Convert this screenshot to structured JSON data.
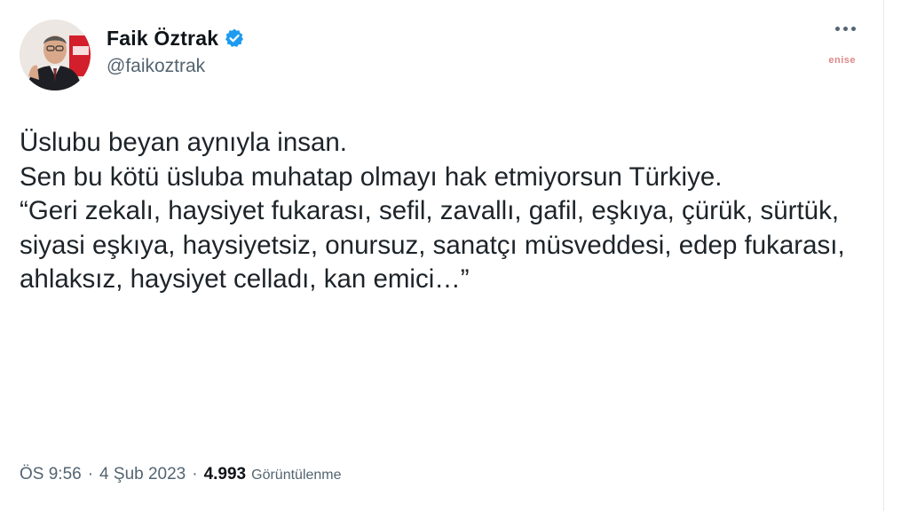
{
  "author": {
    "display_name": "Faik Öztrak",
    "handle": "@faikoztrak",
    "verified": true,
    "avatar_icon": "profile-photo"
  },
  "tweet": {
    "text": "Üslubu beyan aynıyla insan.\nSen bu kötü üsluba muhatap olmayı hak etmiyorsun Türkiye.\n“Geri zekalı, haysiyet fukarası, sefil, zavallı, gafil, eşkıya, çürük, sürtük, siyasi eşkıya, haysiyetsiz, onursuz, sanatçı müsveddesi, edep fukarası, ahlaksız, haysiyet celladı, kan emici…”"
  },
  "meta": {
    "time": "ÖS 9:56",
    "separator": "·",
    "date": "4 Şub 2023",
    "views_count": "4.993",
    "views_label": "Görüntülenme"
  },
  "watermark": "enise",
  "colors": {
    "text": "#0f1419",
    "secondary": "#536471",
    "verified": "#1d9bf0"
  }
}
